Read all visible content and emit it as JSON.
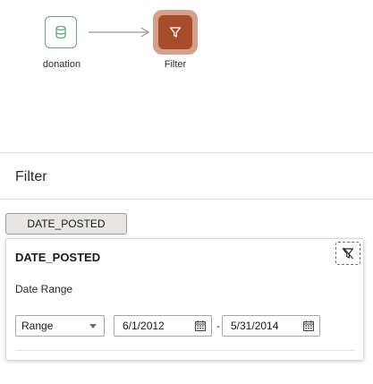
{
  "flow": {
    "source_node": {
      "label": "donation",
      "icon": "database-icon"
    },
    "filter_node": {
      "label": "Filter",
      "icon": "funnel-icon",
      "color": "#a74d2c"
    }
  },
  "panel": {
    "title": "Filter"
  },
  "column_chip": {
    "label": "DATE_POSTED"
  },
  "filter_card": {
    "title": "DATE_POSTED",
    "clear_icon": "clear-filter-icon",
    "field_label": "Date Range",
    "range_select": {
      "value": "Range"
    },
    "start_date": {
      "value": "6/1/2012"
    },
    "separator": "-",
    "end_date": {
      "value": "5/31/2014"
    }
  }
}
